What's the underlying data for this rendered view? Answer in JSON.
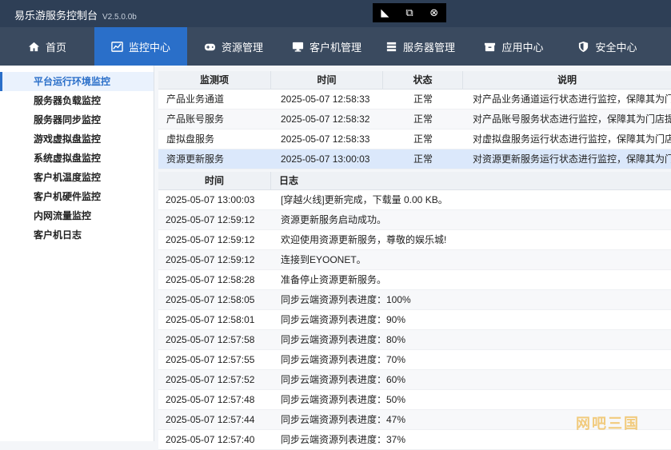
{
  "window": {
    "title": "易乐游服务控制台",
    "version": "V2.5.0.0b"
  },
  "nav": [
    {
      "label": "首页",
      "icon": "home-icon",
      "active": false
    },
    {
      "label": "监控中心",
      "icon": "chart-icon",
      "active": true
    },
    {
      "label": "资源管理",
      "icon": "gamepad-icon",
      "active": false
    },
    {
      "label": "客户机管理",
      "icon": "monitor-icon",
      "active": false
    },
    {
      "label": "服务器管理",
      "icon": "server-icon",
      "active": false
    },
    {
      "label": "应用中心",
      "icon": "package-icon",
      "active": false
    },
    {
      "label": "安全中心",
      "icon": "shield-icon",
      "active": false
    }
  ],
  "sidebar": {
    "items": [
      "平台运行环境监控",
      "服务器负载监控",
      "服务器同步监控",
      "游戏虚拟盘监控",
      "系统虚拟盘监控",
      "客户机温度监控",
      "客户机硬件监控",
      "内网流量监控",
      "客户机日志"
    ]
  },
  "monitor": {
    "headers": [
      "监测项",
      "时间",
      "状态",
      "说明"
    ],
    "rows": [
      [
        "产品业务通道",
        "2025-05-07 12:58:33",
        "正常",
        "对产品业务通道运行状态进行监控，保障其为门"
      ],
      [
        "产品账号服务",
        "2025-05-07 12:58:32",
        "正常",
        "对产品账号服务状态进行监控，保障其为门店提"
      ],
      [
        "虚拟盘服务",
        "2025-05-07 12:58:33",
        "正常",
        "对虚拟盘服务运行状态进行监控，保障其为门店"
      ],
      [
        "资源更新服务",
        "2025-05-07 13:00:03",
        "正常",
        "对资源更新服务运行状态进行监控，保障其为门"
      ]
    ]
  },
  "log": {
    "headers": [
      "时间",
      "日志"
    ],
    "rows": [
      [
        "2025-05-07 13:00:03",
        "[穿越火线]更新完成，下载量 0.00 KB。"
      ],
      [
        "2025-05-07 12:59:12",
        "资源更新服务启动成功。"
      ],
      [
        "2025-05-07 12:59:12",
        "欢迎使用资源更新服务，尊敬的娱乐城!"
      ],
      [
        "2025-05-07 12:59:12",
        "连接到EYOONET。"
      ],
      [
        "2025-05-07 12:58:28",
        "准备停止资源更新服务。"
      ],
      [
        "2025-05-07 12:58:05",
        "同步云端资源列表进度：100%"
      ],
      [
        "2025-05-07 12:58:01",
        "同步云端资源列表进度：90%"
      ],
      [
        "2025-05-07 12:57:58",
        "同步云端资源列表进度：80%"
      ],
      [
        "2025-05-07 12:57:55",
        "同步云端资源列表进度：70%"
      ],
      [
        "2025-05-07 12:57:52",
        "同步云端资源列表进度：60%"
      ],
      [
        "2025-05-07 12:57:48",
        "同步云端资源列表进度：50%"
      ],
      [
        "2025-05-07 12:57:44",
        "同步云端资源列表进度：47%"
      ],
      [
        "2025-05-07 12:57:40",
        "同步云端资源列表进度：37%"
      ]
    ]
  },
  "watermark": "网吧三国"
}
